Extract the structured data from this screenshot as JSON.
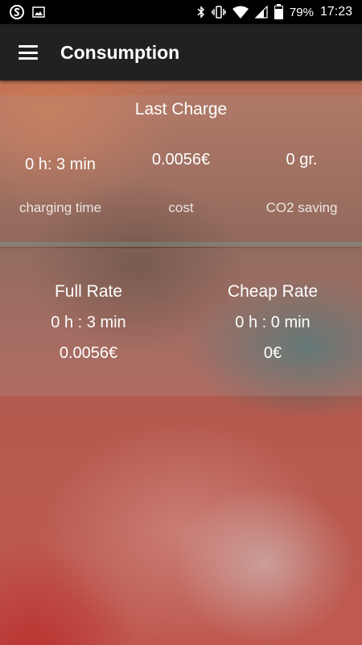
{
  "status_bar": {
    "battery_percent": "79%",
    "time": "17:23",
    "left_icons": [
      "s-app-icon",
      "image-icon"
    ],
    "right_icons": [
      "bluetooth-icon",
      "vibrate-icon",
      "wifi-icon",
      "signal-icon",
      "battery-icon"
    ]
  },
  "app_bar": {
    "title": "Consumption",
    "menu_icon": "hamburger-menu-icon"
  },
  "last_charge": {
    "title": "Last Charge",
    "charging_time_value": "0 h: 3 min",
    "charging_time_label": "charging time",
    "cost_value": "0.0056€",
    "cost_label": "cost",
    "co2_value": "0 gr.",
    "co2_label": "CO2 saving"
  },
  "rates": {
    "full": {
      "title": "Full Rate",
      "time": "0 h : 3 min",
      "cost": "0.0056€"
    },
    "cheap": {
      "title": "Cheap Rate",
      "time": "0 h : 0 min",
      "cost": "0€"
    }
  }
}
